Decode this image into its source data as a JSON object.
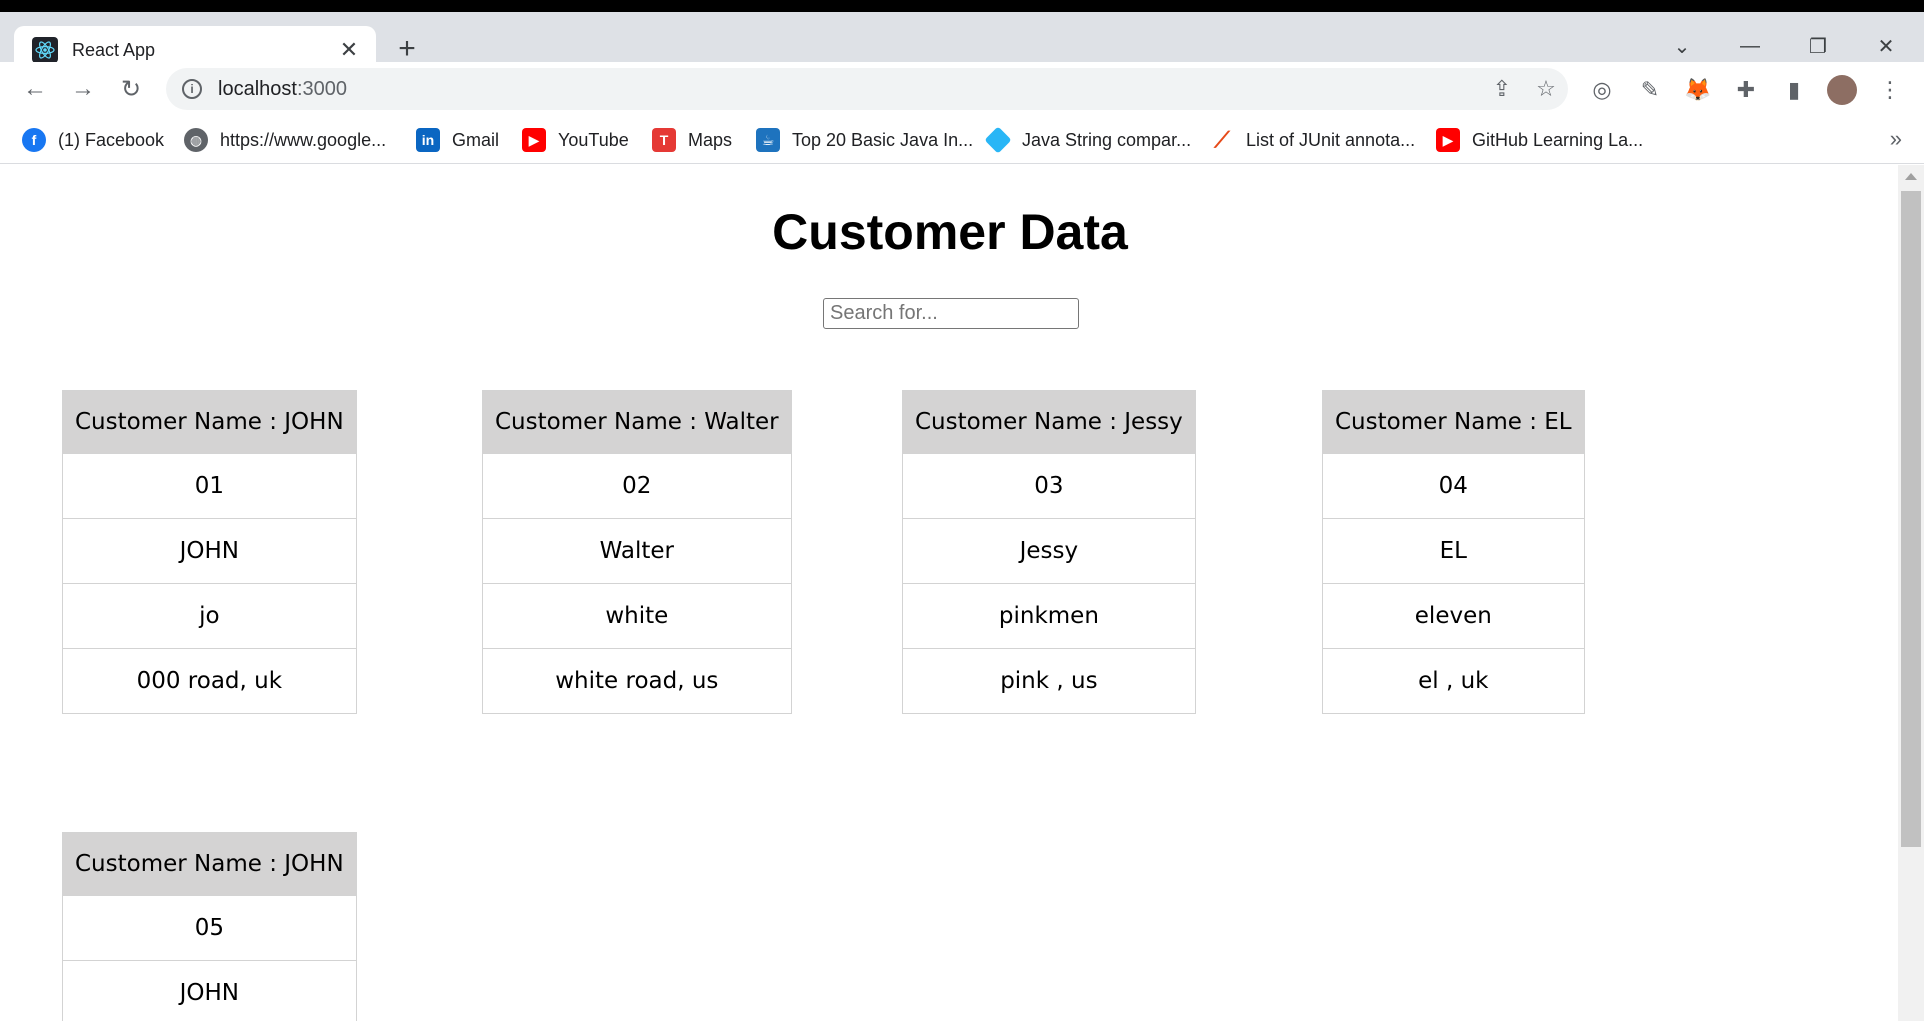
{
  "browser": {
    "tab_title": "React App",
    "url_host": "localhost",
    "url_port": ":3000",
    "bookmarks": [
      {
        "label": "(1) Facebook",
        "icon": "facebook-icon",
        "color": "#1877f2"
      },
      {
        "label": "https://www.google...",
        "icon": "globe-icon",
        "color": "#5f6368"
      },
      {
        "label": "Gmail",
        "icon": "linkedin-icon",
        "color": "#0a66c2"
      },
      {
        "label": "YouTube",
        "icon": "youtube-icon",
        "color": "#ff0000"
      },
      {
        "label": "Maps",
        "icon": "maps-icon",
        "color": "#e53935"
      },
      {
        "label": "Top 20 Basic Java In...",
        "icon": "java-icon",
        "color": "#1e73be"
      },
      {
        "label": "Java String compar...",
        "icon": "diamond-icon",
        "color": "#29b6f6"
      },
      {
        "label": "List of JUnit annota...",
        "icon": "junit-icon",
        "color": "#e64a19"
      },
      {
        "label": "GitHub Learning La...",
        "icon": "youtube-icon",
        "color": "#ff0000"
      }
    ]
  },
  "page": {
    "title": "Customer Data",
    "search_placeholder": "Search for...",
    "customers": [
      {
        "header": "Customer Name : JOHN",
        "id": "01",
        "name": "JOHN",
        "surname": "jo",
        "address": "000 road, uk"
      },
      {
        "header": "Customer Name : Walter",
        "id": "02",
        "name": "Walter",
        "surname": "white",
        "address": "white road, us"
      },
      {
        "header": "Customer Name : Jessy",
        "id": "03",
        "name": "Jessy",
        "surname": "pinkmen",
        "address": "pink , us"
      },
      {
        "header": "Customer Name : EL",
        "id": "04",
        "name": "EL",
        "surname": "eleven",
        "address": "el , uk"
      },
      {
        "header": "Customer Name : JOHN",
        "id": "05",
        "name": "JOHN"
      }
    ]
  }
}
